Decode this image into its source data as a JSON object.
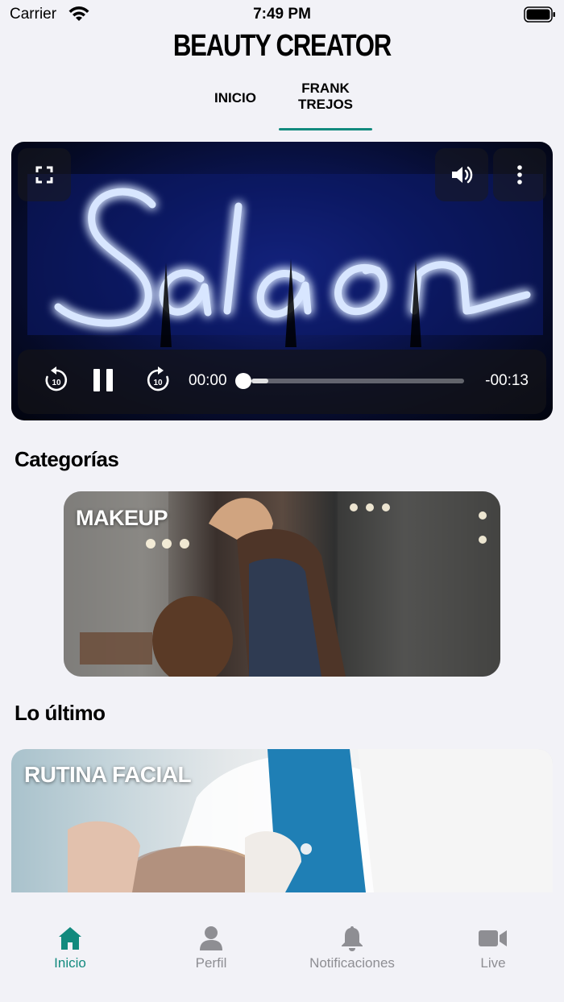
{
  "status_bar": {
    "carrier": "Carrier",
    "time": "7:49 PM"
  },
  "app": {
    "title": "BEAUTY CREATOR"
  },
  "top_tabs": {
    "inicio": "INICIO",
    "frank_line1": "FRANK",
    "frank_line2": "TREJOS",
    "active": "frank"
  },
  "video": {
    "current_time": "00:00",
    "remaining_time": "-00:13",
    "progress": 0.08,
    "skip_seconds": "10",
    "state": "playing"
  },
  "sections": {
    "categories": "Categorías",
    "latest": "Lo último"
  },
  "cards": {
    "makeup": "MAKEUP",
    "facial": "RUTINA FACIAL"
  },
  "bottom_nav": {
    "inicio": "Inicio",
    "perfil": "Perfil",
    "notificaciones": "Notificaciones",
    "live": "Live"
  },
  "colors": {
    "accent": "#128a7e",
    "inactive": "#8e8e93",
    "background": "#f2f2f7"
  }
}
